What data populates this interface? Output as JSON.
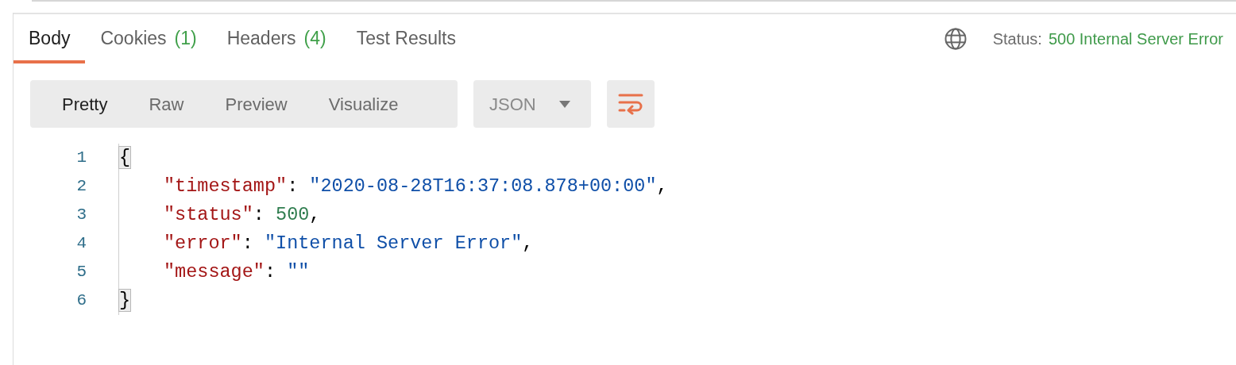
{
  "tabs": [
    {
      "label": "Body",
      "selected": true
    },
    {
      "label": "Cookies",
      "count": "(1)",
      "selected": false
    },
    {
      "label": "Headers",
      "count": "(4)",
      "selected": false
    },
    {
      "label": "Test Results",
      "selected": false
    }
  ],
  "status": {
    "label": "Status:",
    "value": "500 Internal Server Error"
  },
  "view_modes": [
    {
      "label": "Pretty",
      "selected": true
    },
    {
      "label": "Raw",
      "selected": false
    },
    {
      "label": "Preview",
      "selected": false
    },
    {
      "label": "Visualize",
      "selected": false
    }
  ],
  "format": {
    "value": "JSON"
  },
  "code_lines": [
    {
      "number": "1",
      "indented": false,
      "tokens": [
        {
          "kind": "brace",
          "text": "{",
          "matched": true
        }
      ]
    },
    {
      "number": "2",
      "indented": true,
      "tokens": [
        {
          "kind": "key",
          "text": "\"timestamp\""
        },
        {
          "kind": "punct",
          "text": ": "
        },
        {
          "kind": "string",
          "text": "\"2020-08-28T16:37:08.878+00:00\""
        },
        {
          "kind": "punct",
          "text": ","
        }
      ]
    },
    {
      "number": "3",
      "indented": true,
      "tokens": [
        {
          "kind": "key",
          "text": "\"status\""
        },
        {
          "kind": "punct",
          "text": ": "
        },
        {
          "kind": "number",
          "text": "500"
        },
        {
          "kind": "punct",
          "text": ","
        }
      ]
    },
    {
      "number": "4",
      "indented": true,
      "tokens": [
        {
          "kind": "key",
          "text": "\"error\""
        },
        {
          "kind": "punct",
          "text": ": "
        },
        {
          "kind": "string",
          "text": "\"Internal Server Error\""
        },
        {
          "kind": "punct",
          "text": ","
        }
      ]
    },
    {
      "number": "5",
      "indented": true,
      "tokens": [
        {
          "kind": "key",
          "text": "\"message\""
        },
        {
          "kind": "punct",
          "text": ": "
        },
        {
          "kind": "string",
          "text": "\"\""
        }
      ]
    },
    {
      "number": "6",
      "indented": false,
      "tokens": [
        {
          "kind": "brace",
          "text": "}",
          "matched": true
        }
      ]
    }
  ]
}
